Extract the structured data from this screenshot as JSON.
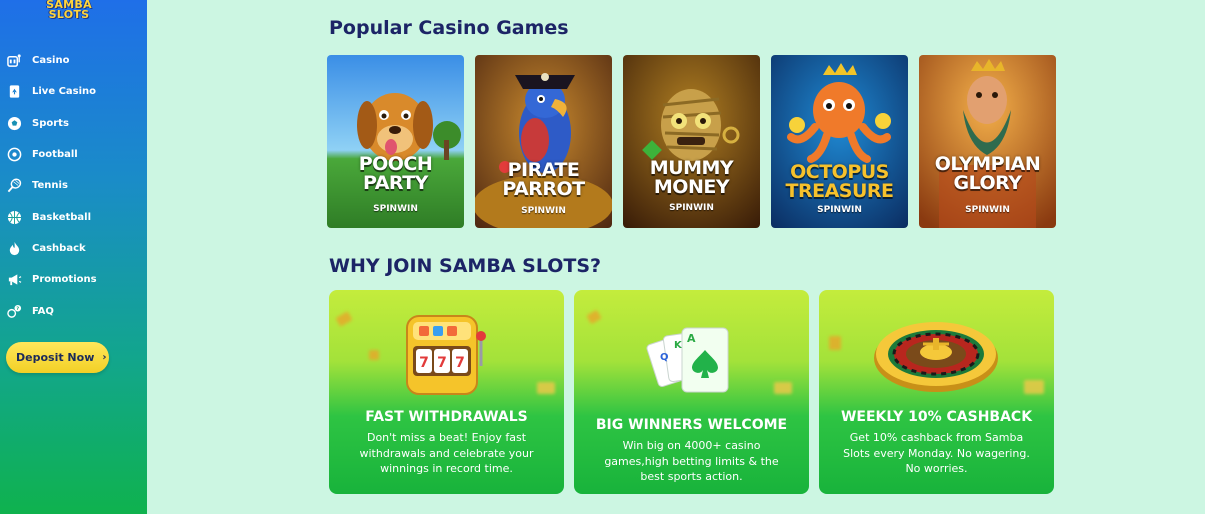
{
  "brand": {
    "logo_line1": "SAMBA",
    "logo_line2": "SLOTS"
  },
  "sidebar": {
    "items": [
      {
        "label": "Casino",
        "icon": "slot-machine-icon"
      },
      {
        "label": "Live Casino",
        "icon": "playing-card-icon"
      },
      {
        "label": "Sports",
        "icon": "soccer-ball-icon"
      },
      {
        "label": "Football",
        "icon": "football-icon"
      },
      {
        "label": "Tennis",
        "icon": "tennis-racket-icon"
      },
      {
        "label": "Basketball",
        "icon": "basketball-icon"
      },
      {
        "label": "Cashback",
        "icon": "flame-icon"
      },
      {
        "label": "Promotions",
        "icon": "megaphone-icon"
      },
      {
        "label": "FAQ",
        "icon": "question-icon"
      }
    ],
    "deposit_label": "Deposit Now",
    "deposit_arrow": "›"
  },
  "popular": {
    "title": "Popular Casino Games",
    "games": [
      {
        "line1": "POOCH",
        "line2": "PARTY",
        "provider": "SPINWIN"
      },
      {
        "line1": "PIRATE",
        "line2": "PARROT",
        "provider": "SPINWIN"
      },
      {
        "line1": "MUMMY",
        "line2": "MONEY",
        "provider": "SPINWIN"
      },
      {
        "line1": "OCTOPUS",
        "line2": "TREASURE",
        "provider": "SPINWIN"
      },
      {
        "line1": "OLYMPIAN",
        "line2": "GLORY",
        "provider": "SPINWIN"
      }
    ]
  },
  "why": {
    "title": "WHY JOIN SAMBA SLOTS?",
    "cards": [
      {
        "title": "FAST WITHDRAWALS",
        "desc": "Don't miss a beat! Enjoy fast withdrawals and celebrate your winnings in record time."
      },
      {
        "title": "BIG WINNERS WELCOME",
        "desc": "Win big on 4000+ casino games,high betting limits & the best sports action."
      },
      {
        "title": "WEEKLY 10% CASHBACK",
        "desc": "Get 10% cashback from Samba Slots every Monday. No wagering. No worries."
      }
    ],
    "card_letters": [
      "Q",
      "K",
      "A"
    ]
  },
  "colors": {
    "navy": "#1c2466",
    "background": "#ccf6e2",
    "deposit": "#f2d026",
    "card_green": "#18b33b"
  }
}
